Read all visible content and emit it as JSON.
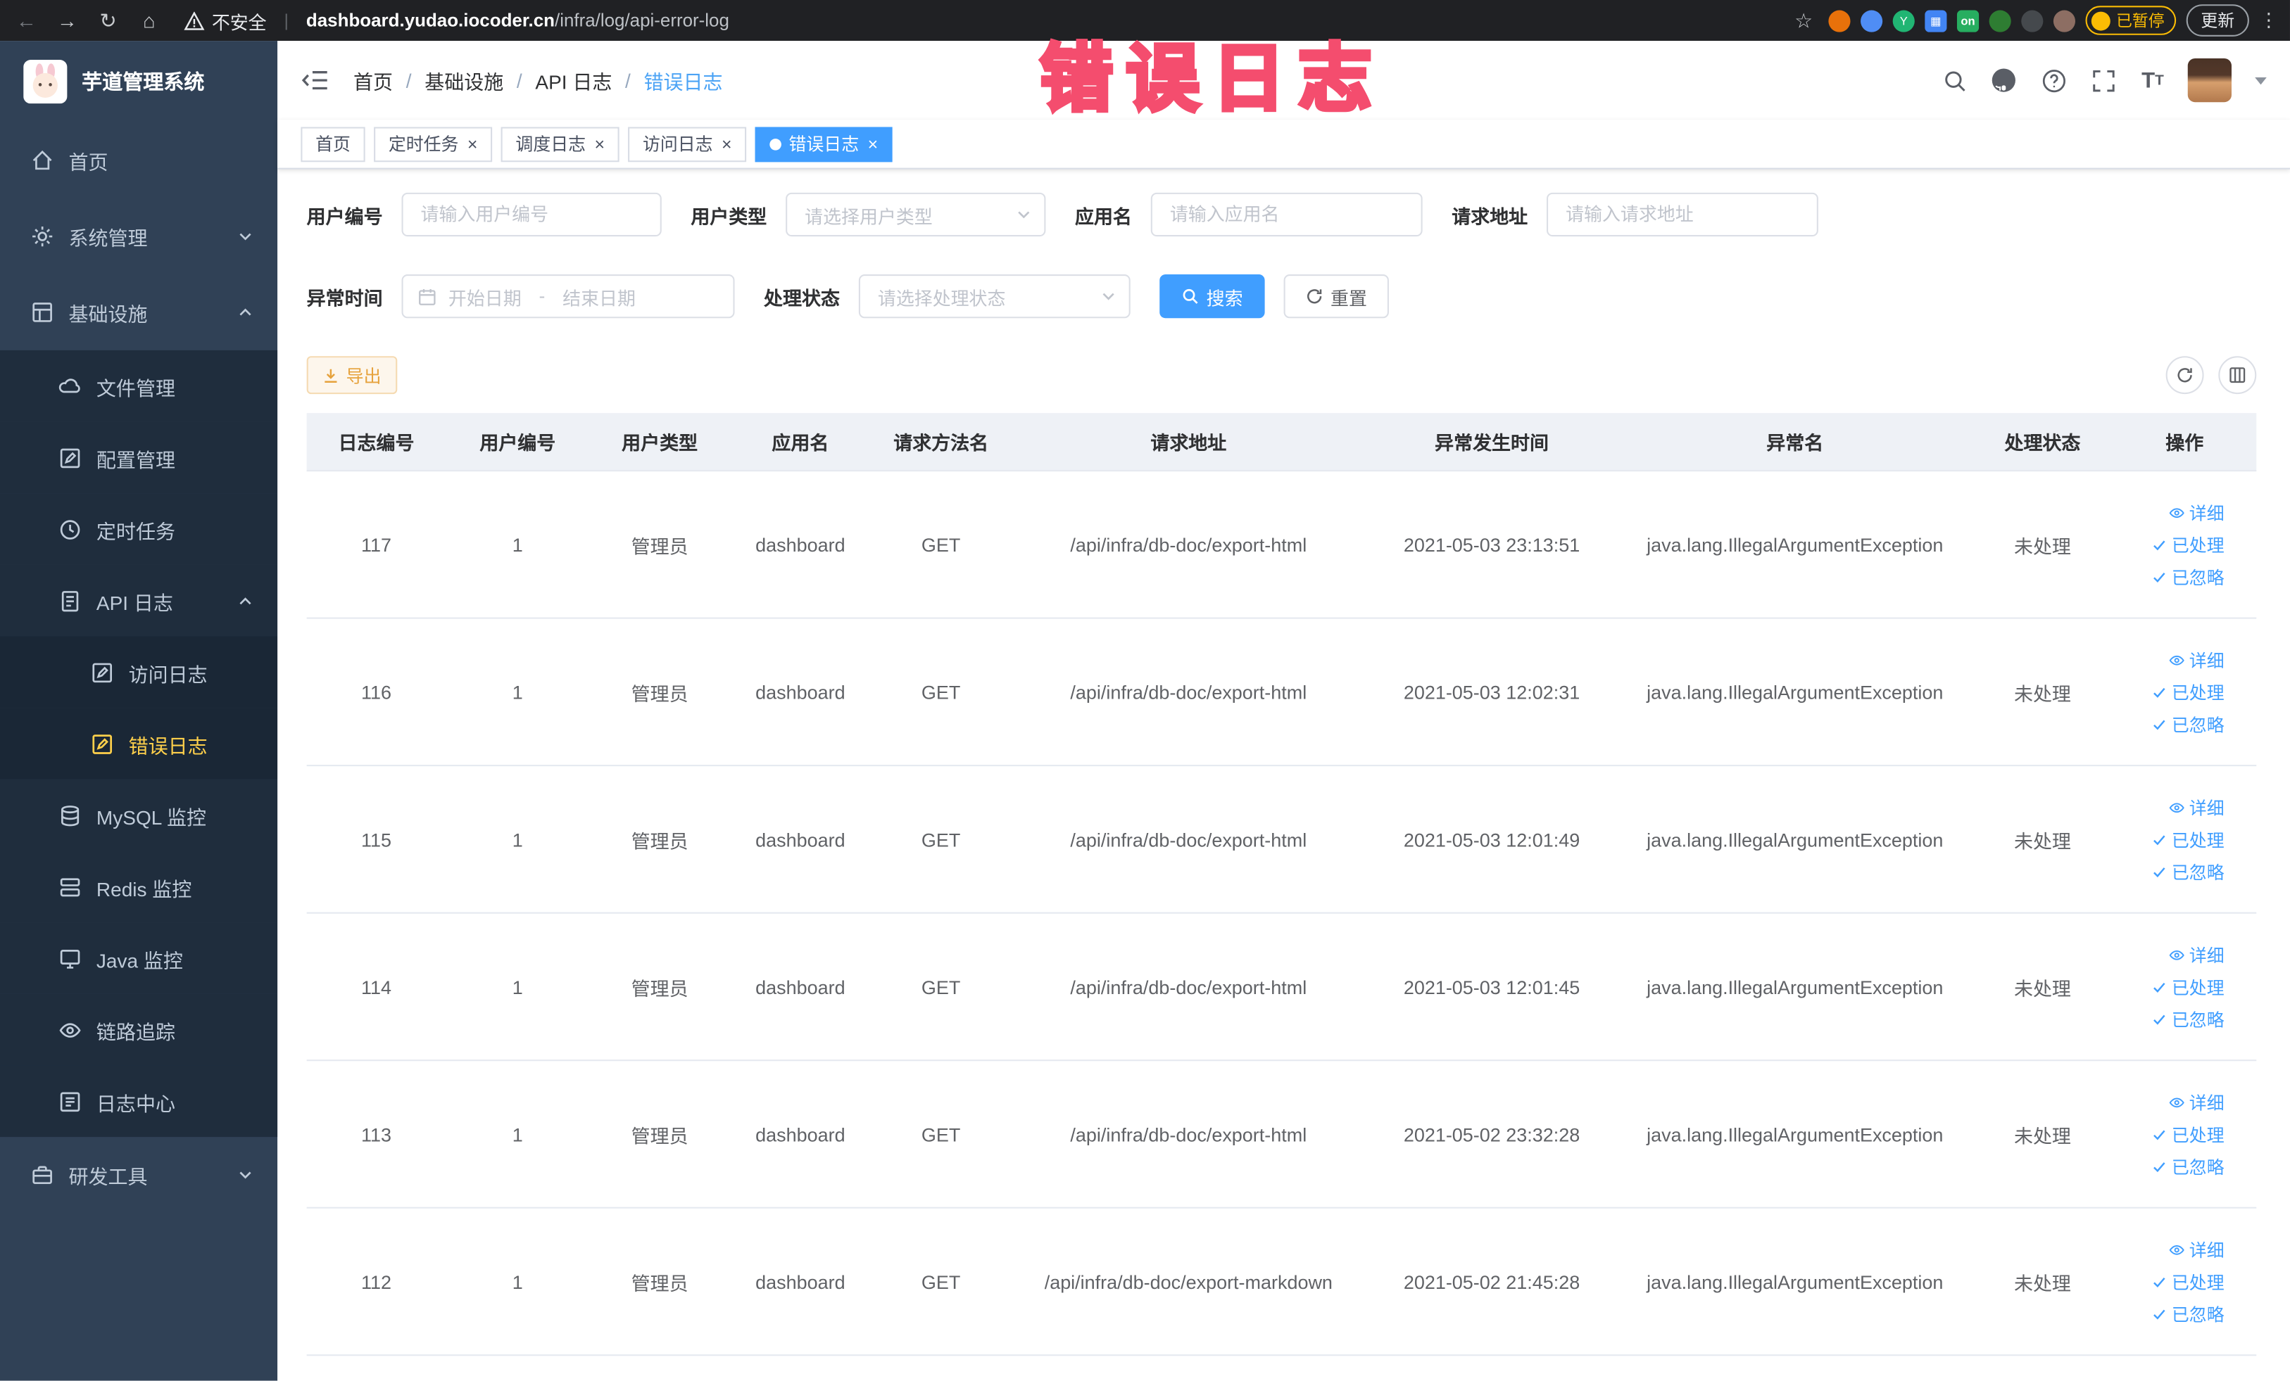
{
  "colors": {
    "accent_blue": "#409eff",
    "sidebar_bg": "#304156",
    "submenu_bg": "#1f2d3d",
    "active_menu_yellow": "#ffd04b",
    "export_orange": "#e6a23c",
    "watermark_pink": "#f44d6e"
  },
  "browser": {
    "security_label": "不安全",
    "url_host": "dashboard.yudao.iocoder.cn",
    "url_path": "/infra/log/api-error-log",
    "ext_on_badge": "on",
    "paused_badge": "已暂停",
    "update_label": "更新"
  },
  "sidebar": {
    "logo_title": "芋道管理系统",
    "home": "首页",
    "system": "系统管理",
    "infra": "基础设施",
    "file_mgmt": "文件管理",
    "config_mgmt": "配置管理",
    "cron_job": "定时任务",
    "api_log": "API 日志",
    "access_log": "访问日志",
    "error_log": "错误日志",
    "mysql": "MySQL 监控",
    "redis": "Redis 监控",
    "java": "Java 监控",
    "trace": "链路追踪",
    "log_center": "日志中心",
    "dev_tools": "研发工具"
  },
  "header": {
    "breadcrumb": [
      "首页",
      "基础设施",
      "API 日志",
      "错误日志"
    ]
  },
  "annotation": {
    "watermark_text": "错误日志"
  },
  "tabs": [
    {
      "label": "首页",
      "active": false,
      "closable": false
    },
    {
      "label": "定时任务",
      "active": false,
      "closable": true
    },
    {
      "label": "调度日志",
      "active": false,
      "closable": true
    },
    {
      "label": "访问日志",
      "active": false,
      "closable": true
    },
    {
      "label": "错误日志",
      "active": true,
      "closable": true
    }
  ],
  "filters": {
    "user_id_label": "用户编号",
    "user_id_placeholder": "请输入用户编号",
    "user_type_label": "用户类型",
    "user_type_placeholder": "请选择用户类型",
    "app_name_label": "应用名",
    "app_name_placeholder": "请输入应用名",
    "request_url_label": "请求地址",
    "request_url_placeholder": "请输入请求地址",
    "exception_time_label": "异常时间",
    "date_start_placeholder": "开始日期",
    "date_separator": "-",
    "date_end_placeholder": "结束日期",
    "process_status_label": "处理状态",
    "process_status_placeholder": "请选择处理状态",
    "search_button": "搜索",
    "reset_button": "重置"
  },
  "toolbar": {
    "export_button": "导出"
  },
  "table": {
    "columns": [
      "日志编号",
      "用户编号",
      "用户类型",
      "应用名",
      "请求方法名",
      "请求地址",
      "异常发生时间",
      "异常名",
      "处理状态",
      "操作"
    ],
    "action_labels": [
      "详细",
      "已处理",
      "已忽略"
    ],
    "rows": [
      {
        "id": "117",
        "user_id": "1",
        "user_type": "管理员",
        "app": "dashboard",
        "method": "GET",
        "url": "/api/infra/db-doc/export-html",
        "time": "2021-05-03 23:13:51",
        "exception": "java.lang.IllegalArgumentException",
        "status": "未处理"
      },
      {
        "id": "116",
        "user_id": "1",
        "user_type": "管理员",
        "app": "dashboard",
        "method": "GET",
        "url": "/api/infra/db-doc/export-html",
        "time": "2021-05-03 12:02:31",
        "exception": "java.lang.IllegalArgumentException",
        "status": "未处理"
      },
      {
        "id": "115",
        "user_id": "1",
        "user_type": "管理员",
        "app": "dashboard",
        "method": "GET",
        "url": "/api/infra/db-doc/export-html",
        "time": "2021-05-03 12:01:49",
        "exception": "java.lang.IllegalArgumentException",
        "status": "未处理"
      },
      {
        "id": "114",
        "user_id": "1",
        "user_type": "管理员",
        "app": "dashboard",
        "method": "GET",
        "url": "/api/infra/db-doc/export-html",
        "time": "2021-05-03 12:01:45",
        "exception": "java.lang.IllegalArgumentException",
        "status": "未处理"
      },
      {
        "id": "113",
        "user_id": "1",
        "user_type": "管理员",
        "app": "dashboard",
        "method": "GET",
        "url": "/api/infra/db-doc/export-html",
        "time": "2021-05-02 23:32:28",
        "exception": "java.lang.IllegalArgumentException",
        "status": "未处理"
      },
      {
        "id": "112",
        "user_id": "1",
        "user_type": "管理员",
        "app": "dashboard",
        "method": "GET",
        "url": "/api/infra/db-doc/export-markdown",
        "time": "2021-05-02 21:45:28",
        "exception": "java.lang.IllegalArgumentException",
        "status": "未处理"
      }
    ]
  }
}
